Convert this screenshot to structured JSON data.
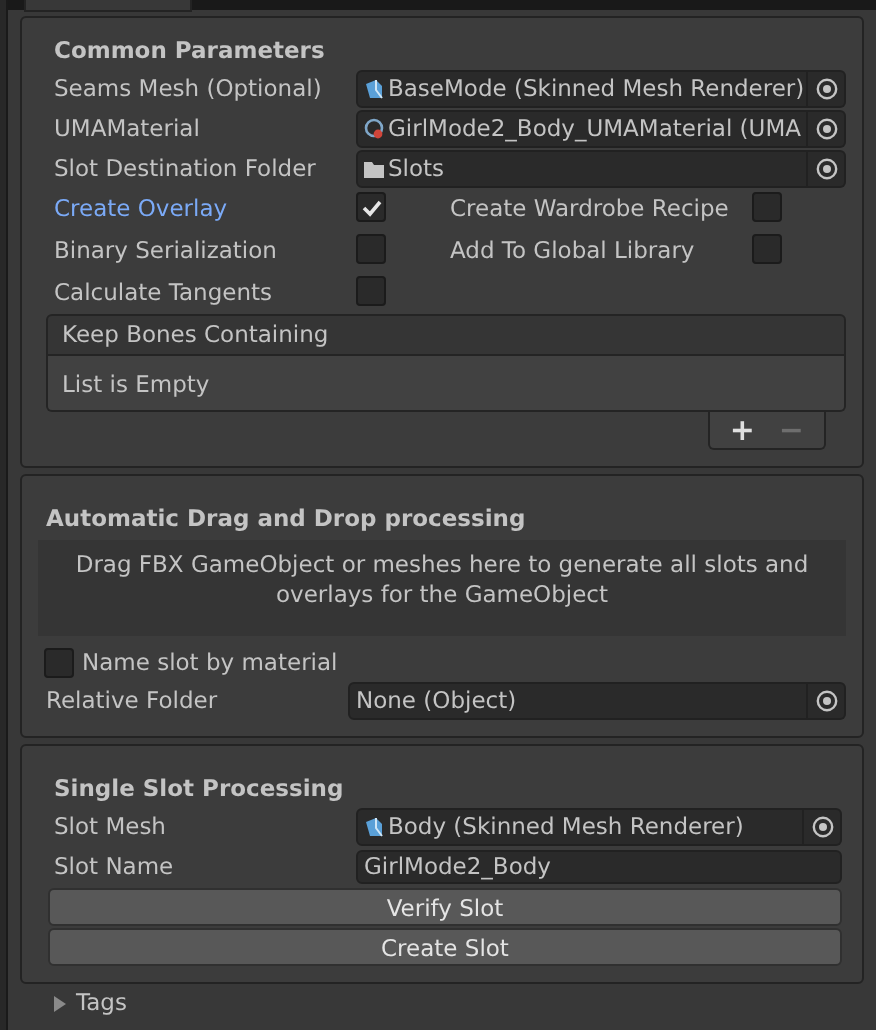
{
  "sections": [
    {
      "title": "Common Parameters",
      "fields": [
        {
          "label": "Seams Mesh (Optional)",
          "value": "BaseMode (Skinned Mesh Renderer)",
          "kind": "mesh"
        },
        {
          "label": "UMAMaterial",
          "value": "GirlMode2_Body_UMAMaterial (UMA",
          "kind": "material"
        },
        {
          "label": "Slot Destination Folder",
          "value": "Slots",
          "kind": "folder"
        }
      ],
      "toggles": [
        {
          "label": "Create Overlay",
          "checked": true,
          "focused": true
        },
        {
          "label": "Create Wardrobe Recipe",
          "checked": false,
          "focused": false
        },
        {
          "label": "Binary Serialization",
          "checked": false,
          "focused": false
        },
        {
          "label": "Add To Global Library",
          "checked": false,
          "focused": false
        },
        {
          "label": "Calculate Tangents",
          "checked": false,
          "focused": false
        }
      ],
      "list": {
        "header": "Keep Bones Containing",
        "empty_text": "List is Empty",
        "add": "+",
        "remove": "−"
      }
    },
    {
      "title": "Automatic Drag and Drop processing",
      "drop_area": "Drag FBX GameObject or meshes here to generate all slots and overlays for the GameObject",
      "name_toggle": {
        "label": "Name slot by material",
        "checked": false
      },
      "fields": [
        {
          "label": "Relative Folder",
          "value": "None (Object)",
          "kind": "none"
        }
      ]
    },
    {
      "title": "Single Slot Processing",
      "fields": [
        {
          "label": "Slot Mesh",
          "value": "Body (Skinned Mesh Renderer)",
          "kind": "mesh"
        }
      ],
      "text_field": {
        "label": "Slot Name",
        "value": "GirlMode2_Body"
      },
      "buttons": [
        "Verify Slot",
        "Create Slot"
      ]
    }
  ],
  "foldout": {
    "label": "Tags",
    "expanded": false
  }
}
